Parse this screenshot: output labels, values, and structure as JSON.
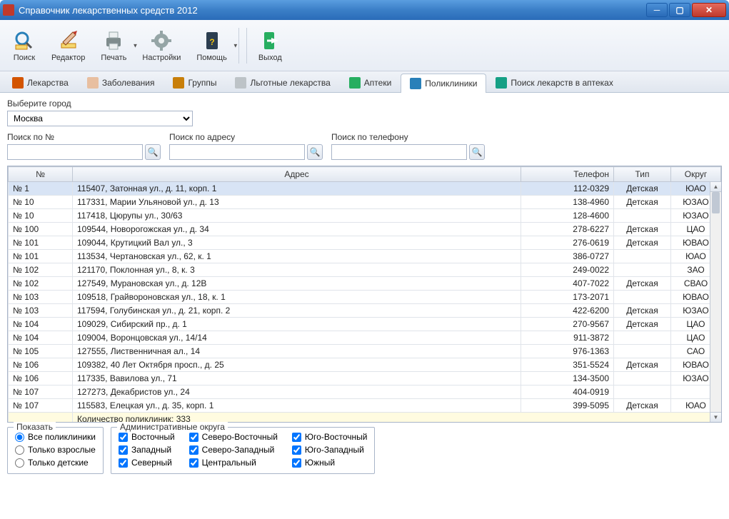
{
  "window": {
    "title": "Справочник лекарственных средств 2012"
  },
  "toolbar": [
    {
      "label": "Поиск",
      "icon": "search",
      "dropdown": false
    },
    {
      "label": "Редактор",
      "icon": "editor",
      "dropdown": false
    },
    {
      "label": "Печать",
      "icon": "print",
      "dropdown": true
    },
    {
      "label": "Настройки",
      "icon": "settings",
      "dropdown": false
    },
    {
      "label": "Помощь",
      "icon": "help",
      "dropdown": true
    },
    {
      "label": "Выход",
      "icon": "exit",
      "dropdown": false
    }
  ],
  "tabs": [
    {
      "label": "Лекарства",
      "icon": "pill",
      "color": "#d35400"
    },
    {
      "label": "Заболевания",
      "icon": "person",
      "color": "#e8bfa0"
    },
    {
      "label": "Группы",
      "icon": "box",
      "color": "#c87f0a"
    },
    {
      "label": "Льготные лекарства",
      "icon": "doc",
      "color": "#bdc3c7"
    },
    {
      "label": "Аптеки",
      "icon": "cross",
      "color": "#27ae60"
    },
    {
      "label": "Поликлиники",
      "icon": "clinic",
      "color": "#2980b9",
      "active": true
    },
    {
      "label": "Поиск лекарств в аптеках",
      "icon": "globe",
      "color": "#16a085"
    }
  ],
  "filters": {
    "city_label": "Выберите город",
    "city_value": "Москва",
    "search_num_label": "Поиск по №",
    "search_addr_label": "Поиск по адресу",
    "search_phone_label": "Поиск по телефону"
  },
  "table": {
    "headers": {
      "num": "№",
      "addr": "Адрес",
      "phone": "Телефон",
      "type": "Тип",
      "district": "Округ"
    },
    "rows": [
      {
        "num": "№ 1",
        "addr": "115407, Затонная ул., д. 11, корп. 1",
        "phone": "112-0329",
        "type": "Детская",
        "district": "ЮАО",
        "selected": true
      },
      {
        "num": "№ 10",
        "addr": "117331, Марии Ульяновой ул., д. 13",
        "phone": "138-4960",
        "type": "Детская",
        "district": "ЮЗАО"
      },
      {
        "num": "№ 10",
        "addr": "117418, Цюрупы ул., 30/63",
        "phone": "128-4600",
        "type": "",
        "district": "ЮЗАО"
      },
      {
        "num": "№ 100",
        "addr": "109544, Новорогожская ул., д. 34",
        "phone": "278-6227",
        "type": "Детская",
        "district": "ЦАО"
      },
      {
        "num": "№ 101",
        "addr": "109044, Крутицкий Вал ул., 3",
        "phone": "276-0619",
        "type": "Детская",
        "district": "ЮВАО"
      },
      {
        "num": "№ 101",
        "addr": "113534, Чертановская ул., 62, к. 1",
        "phone": "386-0727",
        "type": "",
        "district": "ЮАО"
      },
      {
        "num": "№ 102",
        "addr": "121170, Поклонная ул., 8, к. 3",
        "phone": "249-0022",
        "type": "",
        "district": "ЗАО"
      },
      {
        "num": "№ 102",
        "addr": "127549, Мурановская ул., д. 12В",
        "phone": "407-7022",
        "type": "Детская",
        "district": "СВАО"
      },
      {
        "num": "№ 103",
        "addr": "109518, Грайвороновская ул., 18, к. 1",
        "phone": "173-2071",
        "type": "",
        "district": "ЮВАО"
      },
      {
        "num": "№ 103",
        "addr": "117594, Голубинская ул., д. 21, корп. 2",
        "phone": "422-6200",
        "type": "Детская",
        "district": "ЮЗАО"
      },
      {
        "num": "№ 104",
        "addr": "109029, Сибирский пр., д. 1",
        "phone": "270-9567",
        "type": "Детская",
        "district": "ЦАО"
      },
      {
        "num": "№ 104",
        "addr": "109004, Воронцовская ул., 14/14",
        "phone": "911-3872",
        "type": "",
        "district": "ЦАО"
      },
      {
        "num": "№ 105",
        "addr": "127555, Лиственничная ал., 14",
        "phone": "976-1363",
        "type": "",
        "district": "САО"
      },
      {
        "num": "№ 106",
        "addr": "109382, 40 Лет Октября просп., д. 25",
        "phone": "351-5524",
        "type": "Детская",
        "district": "ЮВАО"
      },
      {
        "num": "№ 106",
        "addr": "117335, Вавилова ул., 71",
        "phone": "134-3500",
        "type": "",
        "district": "ЮЗАО"
      },
      {
        "num": "№ 107",
        "addr": "127273, Декабристов ул., 24",
        "phone": "404-0919",
        "type": "",
        "district": ""
      },
      {
        "num": "№ 107",
        "addr": "115583, Елецкая ул., д. 35, корп. 1",
        "phone": "399-5095",
        "type": "Детская",
        "district": "ЮАО"
      }
    ],
    "summary": "Количество поликлиник: 333"
  },
  "show_panel": {
    "title": "Показать",
    "options": [
      {
        "label": "Все поликлиники",
        "checked": true
      },
      {
        "label": "Только взрослые",
        "checked": false
      },
      {
        "label": "Только детские",
        "checked": false
      }
    ]
  },
  "district_panel": {
    "title": "Административные округа",
    "cols": [
      [
        {
          "label": "Восточный",
          "checked": true
        },
        {
          "label": "Западный",
          "checked": true
        },
        {
          "label": "Северный",
          "checked": true
        }
      ],
      [
        {
          "label": "Северо-Восточный",
          "checked": true
        },
        {
          "label": "Северо-Западный",
          "checked": true
        },
        {
          "label": "Центральный",
          "checked": true
        }
      ],
      [
        {
          "label": "Юго-Восточный",
          "checked": true
        },
        {
          "label": "Юго-Западный",
          "checked": true
        },
        {
          "label": "Южный",
          "checked": true
        }
      ]
    ]
  }
}
